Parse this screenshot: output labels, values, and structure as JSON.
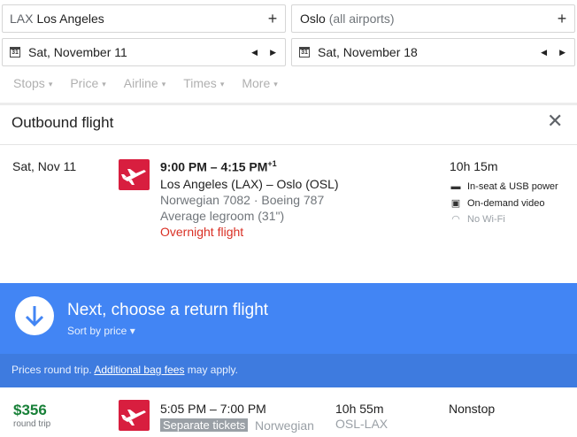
{
  "search": {
    "origin_code": "LAX",
    "origin_city": "Los Angeles",
    "destination_city": "Oslo",
    "destination_note": "(all airports)",
    "depart_date": "Sat, November 11",
    "return_date": "Sat, November 18",
    "plus": "+",
    "calendar_glyph": "31",
    "prev": "◀",
    "next": "▶"
  },
  "filters": [
    "Stops",
    "Price",
    "Airline",
    "Times",
    "More"
  ],
  "filter_caret": "▾",
  "outbound": {
    "title": "Outbound flight",
    "close": "✕",
    "date": "Sat, Nov 11",
    "times": "9:00 PM – 4:15 PM",
    "day_offset": "+1",
    "route": "Los Angeles (LAX) – Oslo (OSL)",
    "flight_info": "Norwegian 7082 · Boeing 787",
    "legroom": "Average legroom (31\")",
    "overnight": "Overnight flight",
    "duration": "10h 15m",
    "amenities": [
      {
        "icon": "power-outlet-icon",
        "glyph": "▬",
        "label": "In-seat & USB power",
        "available": true
      },
      {
        "icon": "video-icon",
        "glyph": "▣",
        "label": "On-demand video",
        "available": true
      },
      {
        "icon": "wifi-icon",
        "glyph": "◠",
        "label": "No Wi-Fi",
        "available": false
      }
    ]
  },
  "banner": {
    "title": "Next, choose a return flight",
    "sort": "Sort by price",
    "sort_caret": "▾",
    "notice_prefix": "Prices round trip.",
    "notice_link": "Additional bag fees",
    "notice_suffix": "may apply."
  },
  "results": [
    {
      "price": "$356",
      "price_note": "round trip",
      "times": "5:05 PM – 7:00 PM",
      "badge": "Separate tickets",
      "airline": "Norwegian",
      "duration": "10h 55m",
      "route": "OSL-LAX",
      "stops": "Nonstop"
    }
  ],
  "colors": {
    "accent": "#4285f4",
    "price": "#188038",
    "warning": "#d93025",
    "airline": "#d81e3f"
  }
}
